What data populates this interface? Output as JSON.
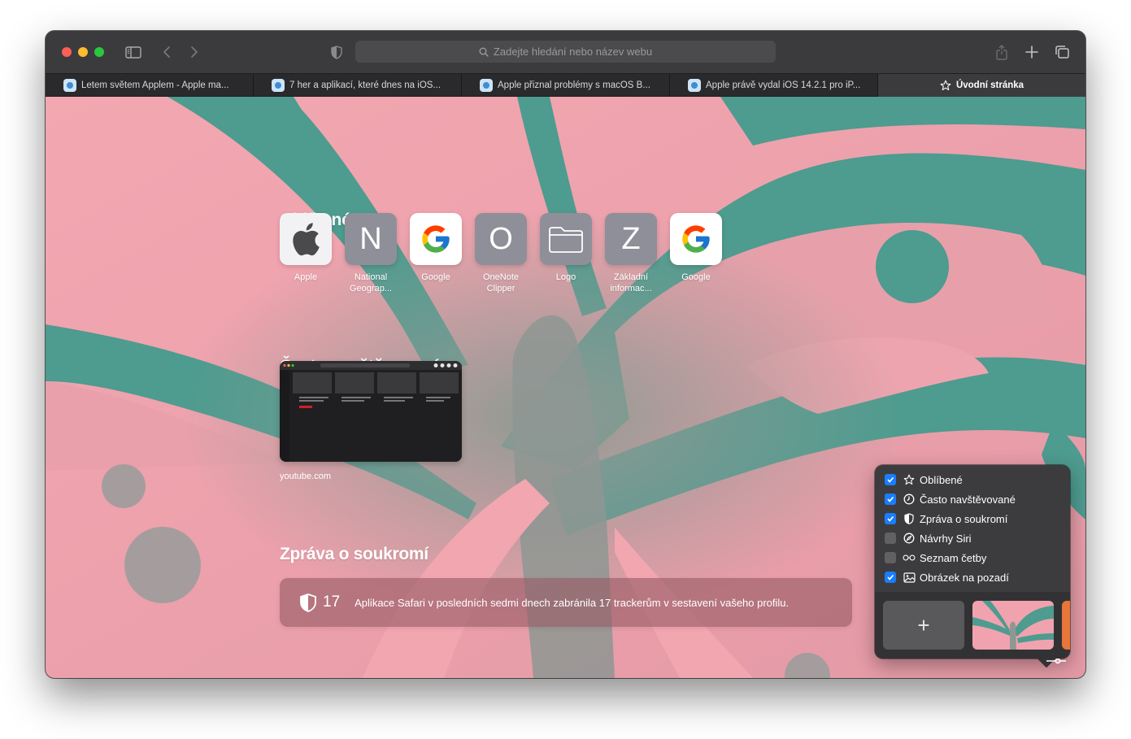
{
  "toolbar": {
    "address_placeholder": "Zadejte hledání nebo název webu",
    "icons": [
      "sidebar-icon",
      "back-icon",
      "forward-icon",
      "privacy-shield-icon",
      "share-icon",
      "new-tab-icon",
      "tab-overview-icon"
    ]
  },
  "tabs": [
    {
      "title": "Letem světem Applem - Apple ma..."
    },
    {
      "title": "7 her a aplikací, které dnes na iOS..."
    },
    {
      "title": "Apple přiznal problémy s macOS B..."
    },
    {
      "title": "Apple právě vydal iOS 14.2.1 pro iP..."
    },
    {
      "title": "Úvodní stránka",
      "active": true
    }
  ],
  "favorites": {
    "title": "Oblíbené",
    "items": [
      {
        "label": "Apple",
        "icon": "apple-logo"
      },
      {
        "label": "National Geograp...",
        "letter": "N"
      },
      {
        "label": "Google",
        "icon": "google-logo"
      },
      {
        "label": "OneNote Clipper",
        "letter": "O"
      },
      {
        "label": "Logo",
        "icon": "folder-icon"
      },
      {
        "label": "Základní informac...",
        "letter": "Z"
      },
      {
        "label": "Google",
        "icon": "google-logo"
      }
    ]
  },
  "frequent": {
    "title": "Často navštěvované",
    "items": [
      {
        "label": "youtube.com"
      }
    ]
  },
  "privacy": {
    "title": "Zpráva o soukromí",
    "count": "17",
    "text": "Aplikace Safari v posledních sedmi dnech zabránila 17 trackerům v sestavení vašeho profilu."
  },
  "customize": {
    "options": [
      {
        "label": "Oblíbené",
        "checked": true,
        "icon": "star-icon"
      },
      {
        "label": "Často navštěvované",
        "checked": true,
        "icon": "clock-icon"
      },
      {
        "label": "Zpráva o soukromí",
        "checked": true,
        "icon": "shield-icon"
      },
      {
        "label": "Návrhy Siri",
        "checked": false,
        "icon": "compass-icon"
      },
      {
        "label": "Seznam četby",
        "checked": false,
        "icon": "glasses-icon"
      },
      {
        "label": "Obrázek na pozadí",
        "checked": true,
        "icon": "image-icon"
      }
    ],
    "add_label": "+"
  },
  "colors": {
    "pink": "#f0a3ae",
    "teal": "#4e9b8f",
    "accent_blue": "#1a7dfd"
  }
}
